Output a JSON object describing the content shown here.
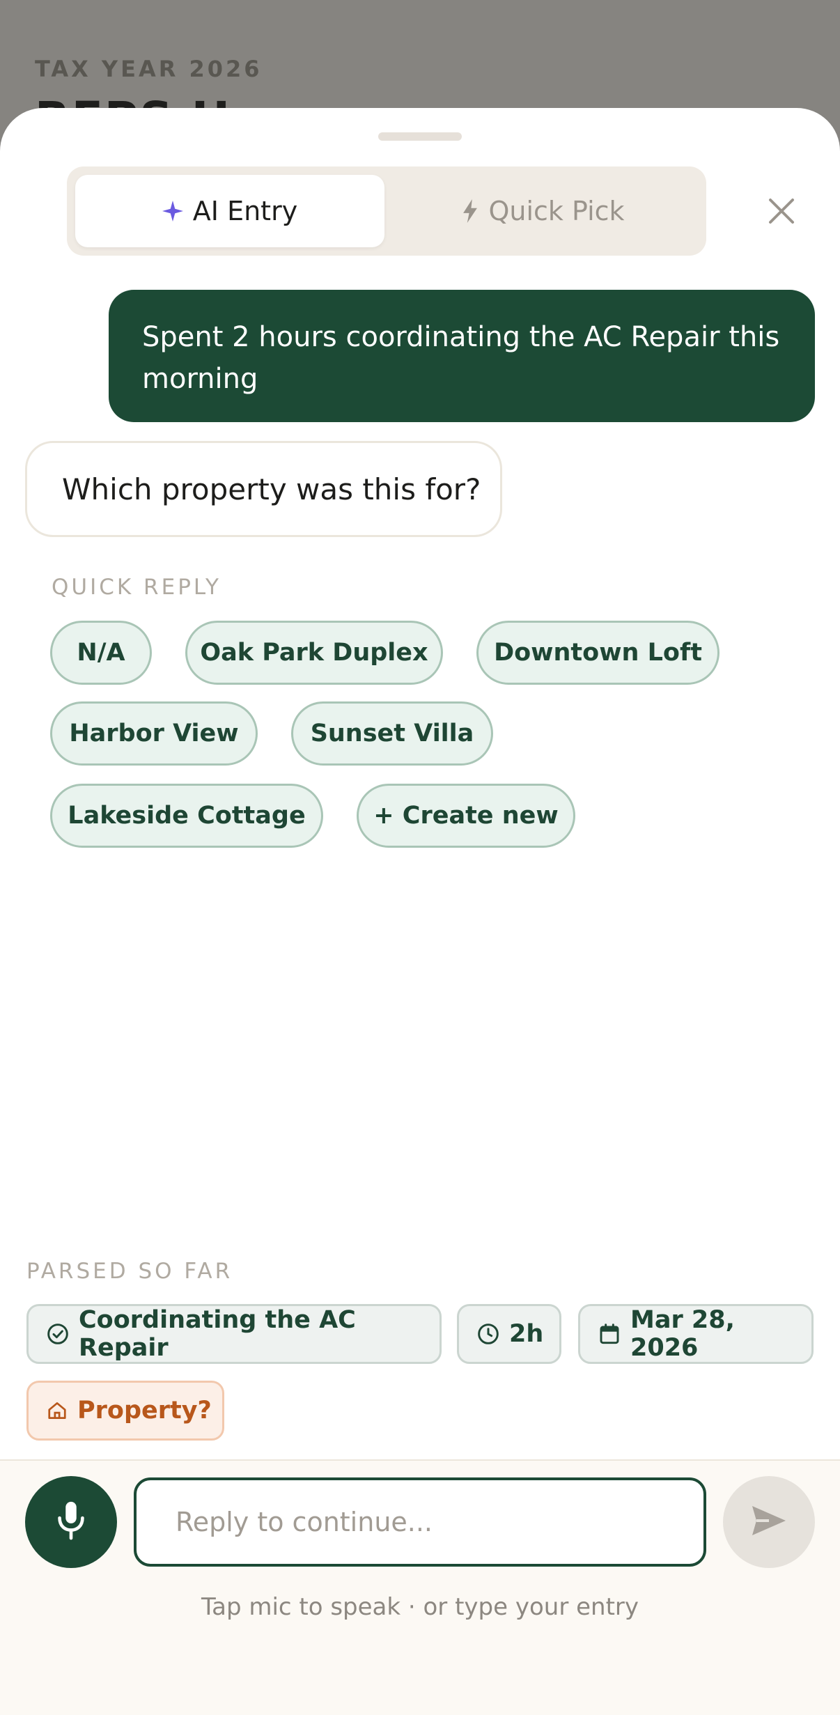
{
  "background": {
    "eyebrow": "TAX YEAR 2026",
    "title": "RFPS H"
  },
  "tabs": [
    {
      "label": "AI Entry",
      "icon": "sparkle-icon",
      "active": true
    },
    {
      "label": "Quick Pick",
      "icon": "bolt-icon",
      "active": false
    }
  ],
  "conversation": {
    "user_message": "Spent 2 hours coordinating the AC Repair this morning",
    "bot_message": "Which property was this for?"
  },
  "quick_reply": {
    "label": "QUICK REPLY",
    "options": [
      "N/A",
      "Oak Park Duplex",
      "Downtown Loft",
      "Harbor View",
      "Sunset Villa",
      "Lakeside Cottage",
      "+ Create new"
    ]
  },
  "parsed": {
    "label": "PARSED SO FAR",
    "task": "Coordinating the AC Repair",
    "duration": "2h",
    "date": "Mar 28, 2026",
    "property": "Property?"
  },
  "composer": {
    "placeholder": "Reply to continue...",
    "hint": "Tap mic to speak · or type your entry"
  },
  "colors": {
    "primary": "#1c4a35",
    "chip_bg": "#e9f3ee",
    "warning": "#b8571b",
    "sparkle": "#6a5ae0"
  }
}
